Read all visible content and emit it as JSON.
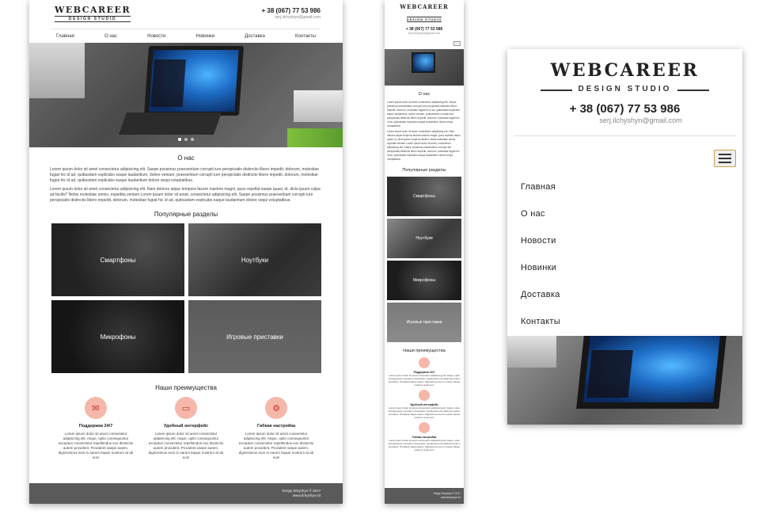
{
  "brand": {
    "name": "WEBCAREER",
    "tagline": "DESIGN STUDIO",
    "phone": "+ 38 (067) 77 53 986",
    "email": "serj.ilchyshyn@gmail.com"
  },
  "nav": {
    "items": [
      "Главная",
      "О нас",
      "Новости",
      "Новинки",
      "Доставка",
      "Контакты"
    ]
  },
  "about": {
    "title": "О нас",
    "para1": "Lorem ipsum dolor sit amet consectetur adipisicing elit. Saepe possimus praesentium corrupti iure perspiciatis distinctio libero impedit, dolorum, molestiae fugiat hic id ad, quibusdam explicabo eaque laudantium, dolore veniam, praesentium corrupti iure perspiciatis distinctio libero impedit, dolorum, molestiae fugiat hic id ad, quibusdam explicabo eaque laudantium dolore sequi voluptatibus.",
    "para2": "Lorem ipsum dolor sit amet consectetur adipisicing elit. Nam dolores atque tempora facere maxime magni, quos repellat saepe quasi, id, dicta ipsum culpa ad facilis? Nobis molestiae omnis, expedita veniam Lorem ipsum dolor sit amet, consectetur adipisicing elit. Saepe possimus praesentium corrupti iure perspiciatis distinctio libero impedit, dolorum, molestiae fugiat hic id ad, quibusdam explicabo eaque laudantium dolore sequi voluptatibus."
  },
  "popular": {
    "title": "Популярные разделы",
    "tiles": [
      "Смартфоны",
      "Ноутбуки",
      "Микрофоны",
      "Игровые приставки"
    ]
  },
  "advantages": {
    "title": "Наши преимущества",
    "items": [
      {
        "icon": "support-icon",
        "title": "Поддержка 24/7",
        "text": "Lorem ipsum dolor sit amet consectetur adipisicing elit. Atque, optio consequuntur excepturi consectetur repellendus eos distinctio autem provident. Provident saepe autem, dignissimos eum in earum itaque nostrum at ab eos!"
      },
      {
        "icon": "monitor-icon",
        "title": "Удобный интерфейс",
        "text": "Lorem ipsum dolor sit amet consectetur adipisicing elit. Atque, optio consequuntur excepturi consectetur repellendus eos distinctio autem provident. Provident saepe autem, dignissimos eum in earum itaque nostrum at ab eos!"
      },
      {
        "icon": "settings-icon",
        "title": "Гибкая настройка",
        "text": "Lorem ipsum dolor sit amet consectetur adipisicing elit. Atque, optio consequuntur excepturi consectetur repellendus eos distinctio autem provident. Provident saepe autem, dignissimos eum in earum itaque nostrum at ab eos!"
      }
    ]
  },
  "footer": {
    "copyright": "Sergiy Ilchyshyn © 2017",
    "site": "www.ilchyshyn.ml"
  },
  "colors": {
    "accent": "#f6b7ab",
    "footer": "#5a5a5a"
  }
}
